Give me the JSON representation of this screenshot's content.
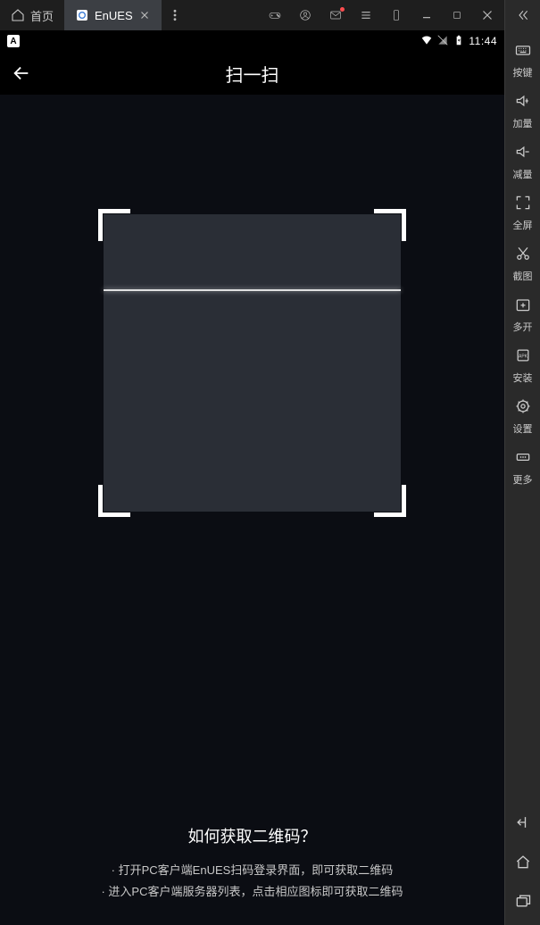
{
  "titlebar": {
    "home_tab_label": "首页",
    "active_tab_label": "EnUES"
  },
  "statusbar": {
    "left_badge": "A",
    "clock": "11:44"
  },
  "app": {
    "title": "扫一扫",
    "help_title": "如何获取二维码？",
    "help_line1": "· 打开PC客户端EnUES扫码登录界面，即可获取二维码",
    "help_line2": "· 进入PC客户端服务器列表，点击相应图标即可获取二维码"
  },
  "sidebar": {
    "items": [
      {
        "label": "按键"
      },
      {
        "label": "加量"
      },
      {
        "label": "减量"
      },
      {
        "label": "全屏"
      },
      {
        "label": "截图"
      },
      {
        "label": "多开"
      },
      {
        "label": "安装"
      },
      {
        "label": "设置"
      },
      {
        "label": "更多"
      }
    ]
  }
}
